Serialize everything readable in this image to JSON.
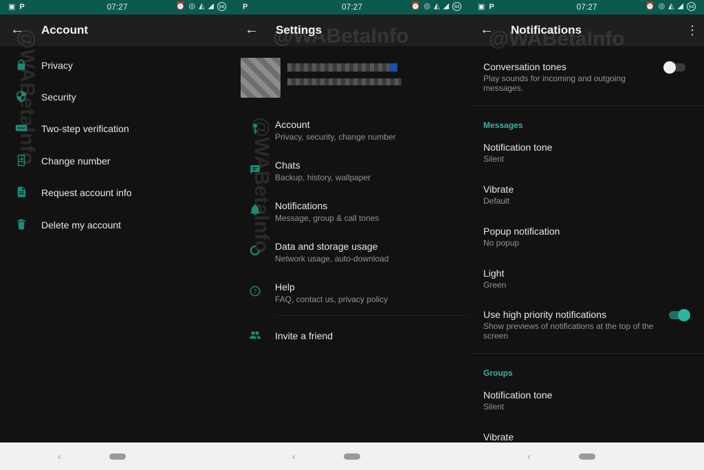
{
  "status_time": "07:27",
  "status_badge": "94",
  "watermark": "@WABetaInfo",
  "colors": {
    "accent": "#39b6a1",
    "status_bar": "#0a5a4f",
    "toolbar": "#1f1f1f",
    "background": "#121212"
  },
  "account": {
    "title": "Account",
    "items": [
      {
        "label": "Privacy",
        "icon": "lock-icon"
      },
      {
        "label": "Security",
        "icon": "shield-icon"
      },
      {
        "label": "Two-step verification",
        "icon": "dots-keypad-icon"
      },
      {
        "label": "Change number",
        "icon": "phone-change-icon"
      },
      {
        "label": "Request account info",
        "icon": "document-icon"
      },
      {
        "label": "Delete my account",
        "icon": "trash-icon"
      }
    ]
  },
  "settings": {
    "title": "Settings",
    "items": [
      {
        "title": "Account",
        "subtitle": "Privacy, security, change number",
        "icon": "key-icon"
      },
      {
        "title": "Chats",
        "subtitle": "Backup, history, wallpaper",
        "icon": "chat-icon"
      },
      {
        "title": "Notifications",
        "subtitle": "Message, group & call tones",
        "icon": "bell-icon"
      },
      {
        "title": "Data and storage usage",
        "subtitle": "Network usage, auto-download",
        "icon": "data-usage-icon"
      },
      {
        "title": "Help",
        "subtitle": "FAQ, contact us, privacy policy",
        "icon": "help-icon"
      }
    ],
    "invite": {
      "label": "Invite a friend",
      "icon": "people-icon"
    }
  },
  "notifications": {
    "title": "Notifications",
    "conversation_tones": {
      "title": "Conversation tones",
      "subtitle": "Play sounds for incoming and outgoing messages.",
      "enabled": false
    },
    "messages_header": "Messages",
    "messages": [
      {
        "title": "Notification tone",
        "value": "Silent"
      },
      {
        "title": "Vibrate",
        "value": "Default"
      },
      {
        "title": "Popup notification",
        "value": "No popup"
      },
      {
        "title": "Light",
        "value": "Green"
      }
    ],
    "high_priority": {
      "title": "Use high priority notifications",
      "subtitle": "Show previews of notifications at the top of the screen",
      "enabled": true
    },
    "groups_header": "Groups",
    "groups": [
      {
        "title": "Notification tone",
        "value": "Silent"
      },
      {
        "title": "Vibrate",
        "value": ""
      }
    ]
  }
}
